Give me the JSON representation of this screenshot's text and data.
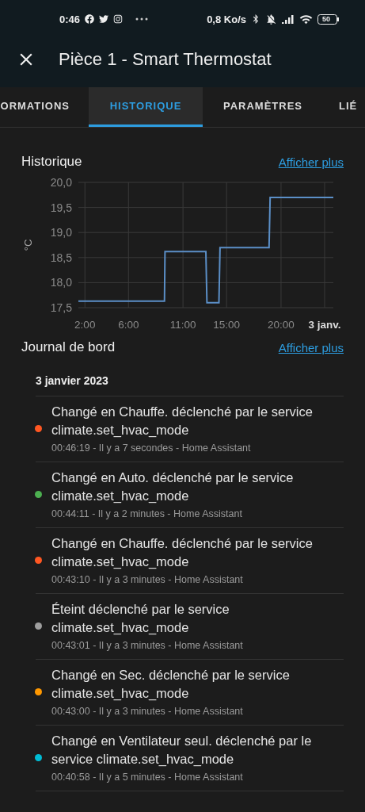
{
  "status_bar": {
    "time": "0:46",
    "speed": "0,8 Ko/s",
    "battery": "50"
  },
  "app_bar": {
    "title": "Pièce 1 - Smart Thermostat"
  },
  "tabs": [
    {
      "label": "ORMATIONS",
      "selected": false
    },
    {
      "label": "HISTORIQUE",
      "selected": true
    },
    {
      "label": "PARAMÈTRES",
      "selected": false
    },
    {
      "label": "LIÉ",
      "selected": false
    }
  ],
  "history": {
    "title": "Historique",
    "link": "Afficher plus",
    "chart_data": {
      "type": "line",
      "grid": true,
      "ylabel": "°C",
      "xlim": [
        1.4,
        24.8
      ],
      "ylim": [
        17.5,
        20
      ],
      "yticks": [
        {
          "value": 17.5,
          "label": "17,5"
        },
        {
          "value": 18,
          "label": "18,0"
        },
        {
          "value": 18.5,
          "label": "18,5"
        },
        {
          "value": 19,
          "label": "19,0"
        },
        {
          "value": 19.5,
          "label": "19,5"
        },
        {
          "value": 20,
          "label": "20,0"
        }
      ],
      "xticks": [
        {
          "value": 2,
          "label": "2:00"
        },
        {
          "value": 6,
          "label": "6:00"
        },
        {
          "value": 11,
          "label": "11:00"
        },
        {
          "value": 15,
          "label": "15:00"
        },
        {
          "value": 20,
          "label": "20:00"
        },
        {
          "value": 24,
          "label": "3 janv."
        }
      ],
      "x": [
        1.4,
        9.3,
        9.35,
        13.1,
        13.2,
        14.3,
        14.4,
        18.9,
        19.0,
        24.8
      ],
      "series": [
        {
          "color": "#5b8fc7",
          "values": [
            17.63,
            17.63,
            18.62,
            18.62,
            17.6,
            17.6,
            18.7,
            18.7,
            19.7,
            19.7
          ]
        }
      ]
    }
  },
  "logbook": {
    "title": "Journal de bord",
    "link": "Afficher plus",
    "date": "3 janvier 2023",
    "entries": [
      {
        "message": "Changé en Chauffe. déclenché par le service climate.set_hvac_mode",
        "meta": "00:46:19 - Il y a 7 secondes - Home Assistant",
        "color": "#ff5722"
      },
      {
        "message": "Changé en Auto. déclenché par le service climate.set_hvac_mode",
        "meta": "00:44:11 - Il y a 2 minutes - Home Assistant",
        "color": "#4caf50"
      },
      {
        "message": "Changé en Chauffe. déclenché par le service climate.set_hvac_mode",
        "meta": "00:43:10 - Il y a 3 minutes - Home Assistant",
        "color": "#ff5722"
      },
      {
        "message": "Éteint déclenché par le service climate.set_hvac_mode",
        "meta": "00:43:01 - Il y a 3 minutes - Home Assistant",
        "color": "#9e9e9e"
      },
      {
        "message": "Changé en Sec. déclenché par le service climate.set_hvac_mode",
        "meta": "00:43:00 - Il y a 3 minutes - Home Assistant",
        "color": "#ff9800"
      },
      {
        "message": "Changé en Ventilateur seul. déclenché par le service climate.set_hvac_mode",
        "meta": "00:40:58 - Il y a 5 minutes - Home Assistant",
        "color": "#00bcd4"
      }
    ]
  }
}
